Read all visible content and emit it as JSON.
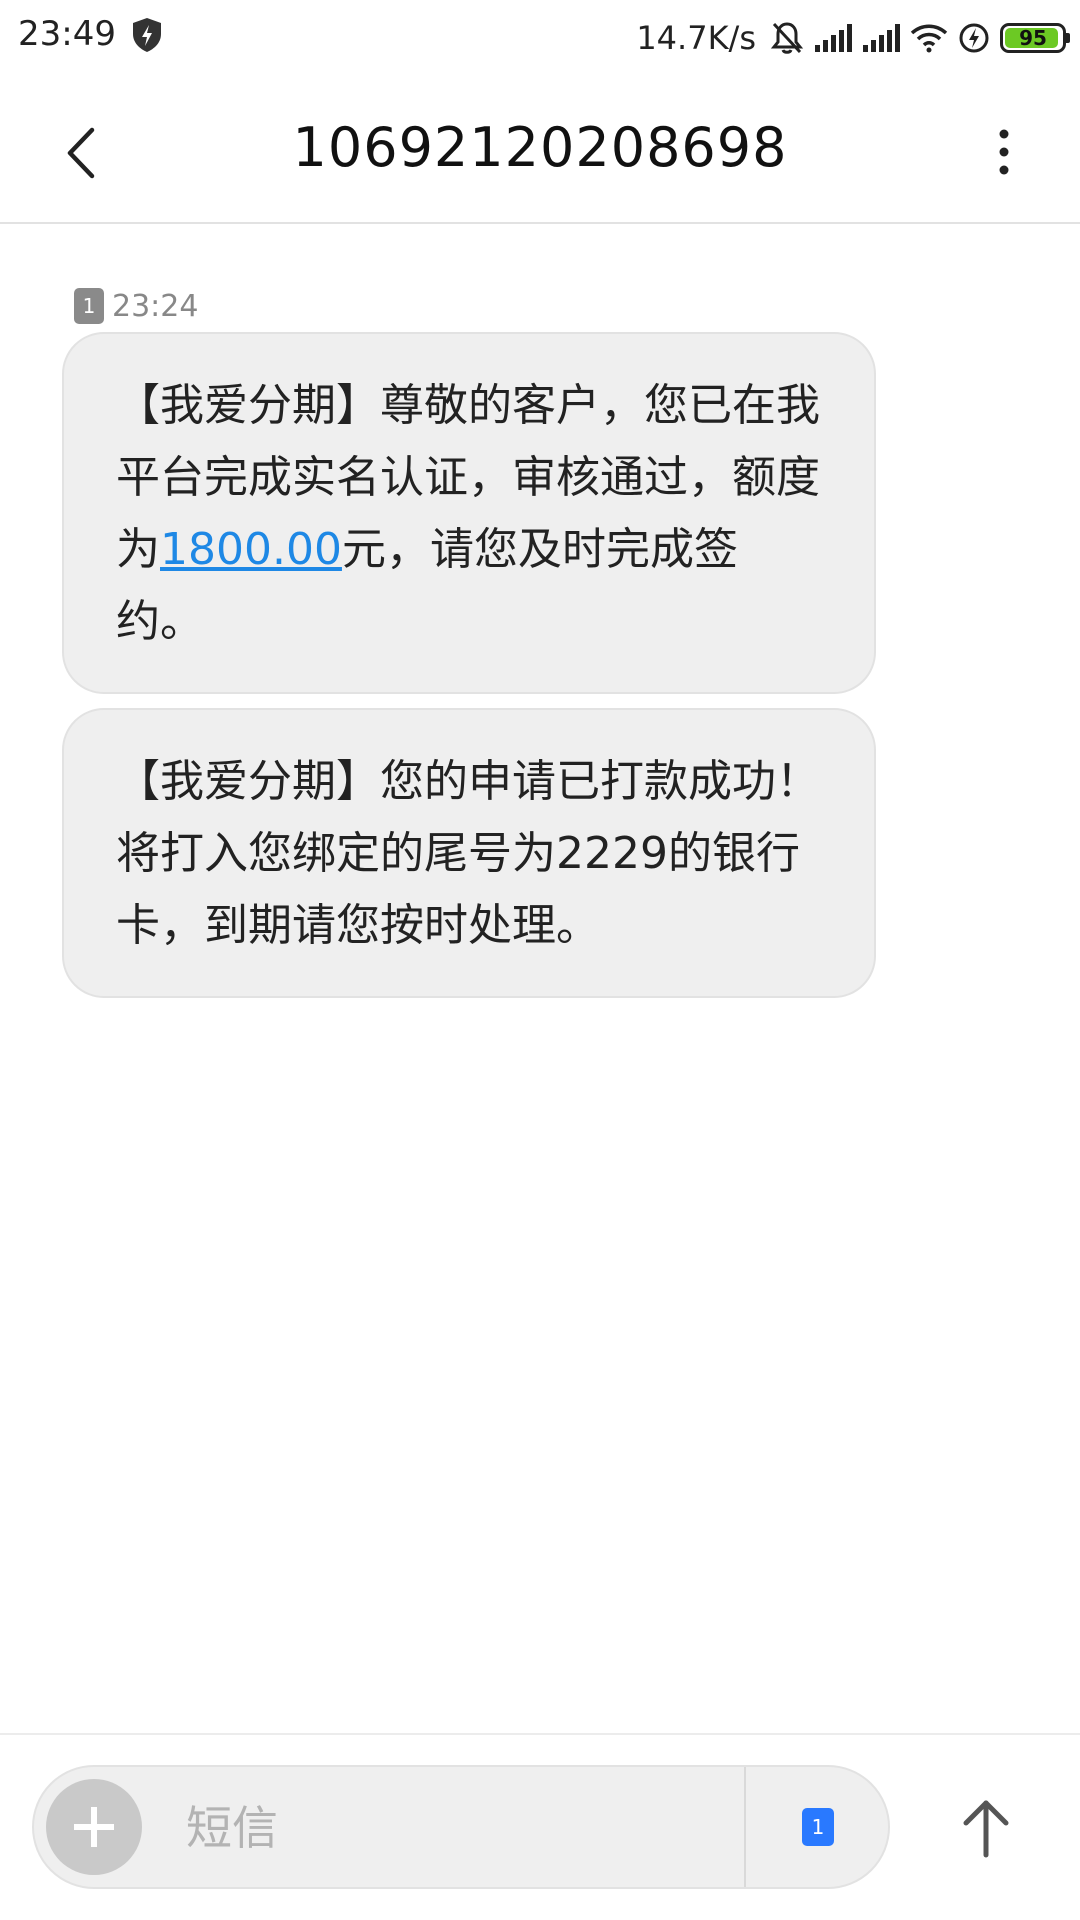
{
  "status_bar": {
    "time": "23:49",
    "network_speed": "14.7K/s",
    "battery_level": "95",
    "battery_fraction": 0.95,
    "icons": [
      "shield-icon",
      "mute-bell-icon",
      "signal-icon",
      "signal-icon",
      "wifi-icon",
      "charging-icon",
      "battery-icon"
    ]
  },
  "header": {
    "title": "10692120208698",
    "back_icon": "chevron-left-icon",
    "more_icon": "more-vertical-icon"
  },
  "messages": {
    "sim_badge": "1",
    "time": "23:24",
    "items": [
      {
        "text_before": "【我爱分期】尊敬的客户，您已在我平台完成实名认证，审核通过，额度为",
        "link": "1800.00",
        "text_after": "元，请您及时完成签约。"
      },
      {
        "text": "【我爱分期】您的申请已打款成功！将打入您绑定的尾号为2229的银行卡，到期请您按时处理。"
      }
    ]
  },
  "composer": {
    "placeholder": "短信",
    "sim_badge": "1",
    "attach_icon": "plus-icon",
    "send_icon": "arrow-up-icon"
  },
  "colors": {
    "bubble": "#efefef",
    "link": "#1e88e5",
    "battery": "#6cc924",
    "sim_select": "#2979ff"
  }
}
